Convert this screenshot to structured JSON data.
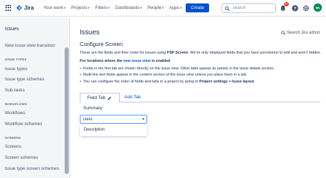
{
  "topnav": {
    "logo_text": "Jira",
    "items": [
      {
        "label": "Your work"
      },
      {
        "label": "Projects"
      },
      {
        "label": "Filters"
      },
      {
        "label": "Dashboards"
      },
      {
        "label": "People"
      },
      {
        "label": "Apps"
      }
    ],
    "create_label": "Create",
    "search_placeholder": "Search",
    "notification_count": "9+",
    "avatar_initials": "NK",
    "accent_color": "#0052cc"
  },
  "sidebar": {
    "title": "Issues",
    "items": [
      {
        "label": "New issue view transition"
      },
      {
        "label": "ISSUE TYPES",
        "heading": true
      },
      {
        "label": "Issue types"
      },
      {
        "label": "Issue type schemes"
      },
      {
        "label": "Sub-tasks"
      },
      {
        "label": "WORKFLOWS",
        "heading": true
      },
      {
        "label": "Workflows"
      },
      {
        "label": "Workflow schemes"
      },
      {
        "label": "SCREENS",
        "heading": true
      },
      {
        "label": "Screens"
      },
      {
        "label": "Screen schemes"
      },
      {
        "label": "Issue type screen schemes"
      }
    ]
  },
  "main": {
    "title": "Issues",
    "search_admin_label": "Search Jira admin",
    "subtitle": "Configure Screen",
    "desc_pre": "These are the fields and their order for issues using ",
    "desc_bold": "FSP Screen",
    "desc_post": ". We've only displayed fields that you have permission to edit and aren't hidden.",
    "note_pre": "For locations where the ",
    "note_link": "new issue view",
    "note_post": " is enabled",
    "bullets": {
      "b1": "Fields in the first tab are shown directly on the issue view. Other tabs appear as panels in the issue details section.",
      "b2": "Multi-line text fields appear in the content section of the issue view unless you place them in a tab.",
      "b3_pre": "You can configure the order of fields and tabs in a project by going to ",
      "b3_bold": "Project settings > Issue layout",
      "b3_post": "."
    },
    "tab_active": "Field Tab",
    "add_tab": "Add Tab",
    "field_summary": "Summary",
    "select_value": "Desc",
    "dropdown_option": "Description"
  }
}
